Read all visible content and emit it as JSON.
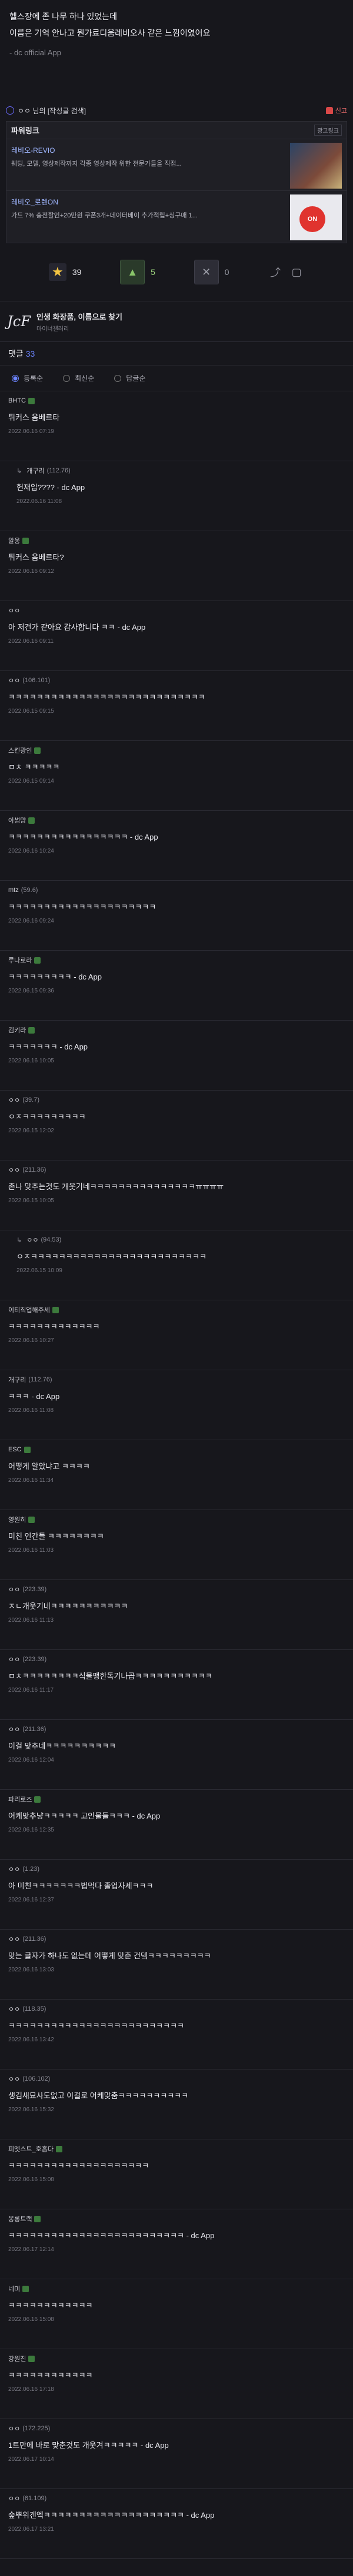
{
  "post": {
    "lines": [
      "헬스장에 존 나무 하나 있었는데",
      "이름은 기억 안나고 뭔가료디움레비오사 같은 느낌이였어요"
    ],
    "signature": "- dc official App"
  },
  "user_bar": {
    "user": "ㅇㅇ 님의 [작성글 검색]",
    "report": "신고"
  },
  "ad": {
    "header": "파워링크",
    "ad_label": "광고링크",
    "items": [
      {
        "title": "레비오-REVIO",
        "desc": "웨딩, 모델, 영상제작까지 각종 영상제작 위한 전문가들을 직접..."
      },
      {
        "title": "레비오_로렌ON",
        "desc": "가드 7% 충전할인+20만원 쿠폰3개+데이터베이 추가적립+싱구매 1..."
      }
    ]
  },
  "actions": {
    "star_count": "39",
    "up_count": "5",
    "down_count": "0"
  },
  "gallery": {
    "name": "인생 화장품, 이름으로 찾기",
    "sub": "마이너갤러리"
  },
  "comments_header": {
    "label": "댓글",
    "count": "33"
  },
  "sort": [
    "등록순",
    "최신순",
    "답글순"
  ],
  "comments": [
    {
      "reply": false,
      "nick": "BHTC",
      "ip": "",
      "gall": true,
      "body": "튀커스 옴베르타",
      "date": "2022.06.16 07:19"
    },
    {
      "reply": true,
      "nick": "개구리",
      "ip": "(112.76)",
      "gall": false,
      "body": "헌재입???? - dc App",
      "date": "2022.06.16 11:08"
    },
    {
      "reply": false,
      "nick": "알옹",
      "ip": "",
      "gall": true,
      "body": "튀커스 옴베르타?",
      "date": "2022.06.16 09:12"
    },
    {
      "reply": false,
      "nick": "ㅇㅇ",
      "ip": "",
      "gall": false,
      "body": "아 저건가 같아요 감사합니다 ㅋㅋ - dc App",
      "date": "2022.06.16 09:11"
    },
    {
      "reply": false,
      "nick": "ㅇㅇ",
      "ip": "(106.101)",
      "gall": false,
      "body": "ㅋㅋㅋㅋㅋㅋㅋㅋㅋㅋㅋㅋㅋㅋㅋㅋㅋㅋㅋㅋㅋㅋㅋㅋㅋㅋㅋㅋ",
      "date": "2022.06.15 09:15"
    },
    {
      "reply": false,
      "nick": "스킨광인",
      "ip": "",
      "gall": true,
      "body": "ㅁㅊ ㅋㅋㅋㅋㅋ",
      "date": "2022.06.15 09:14"
    },
    {
      "reply": false,
      "nick": "아썸맘",
      "ip": "",
      "gall": true,
      "body": "ㅋㅋㅋㅋㅋㅋㅋㅋㅋㅋㅋㅋㅋㅋㅋㅋㅋ - dc App",
      "date": "2022.06.16 10:24"
    },
    {
      "reply": false,
      "nick": "mtz",
      "ip": "(59.6)",
      "gall": false,
      "body": "ㅋㅋㅋㅋㅋㅋㅋㅋㅋㅋㅋㅋㅋㅋㅋㅋㅋㅋㅋㅋㅋ",
      "date": "2022.06.16 09:24"
    },
    {
      "reply": false,
      "nick": "루나로라",
      "ip": "",
      "gall": true,
      "body": "ㅋㅋㅋㅋㅋㅋㅋㅋㅋ - dc App",
      "date": "2022.06.15 09:36"
    },
    {
      "reply": false,
      "nick": "김키라",
      "ip": "",
      "gall": true,
      "body": "ㅋㅋㅋㅋㅋㅋㅋ - dc App",
      "date": "2022.06.16 10:05"
    },
    {
      "reply": false,
      "nick": "ㅇㅇ",
      "ip": "(39.7)",
      "gall": false,
      "body": "ㅇㅈㅋㅋㅋㅋㅋㅋㅋㅋㅋ",
      "date": "2022.06.15 12:02"
    },
    {
      "reply": false,
      "nick": "ㅇㅇ",
      "ip": "(211.36)",
      "gall": false,
      "body": "존나 맞추는것도 개웃기네ㅋㅋㅋㅋㅋㅋㅋㅋㅋㅋㅋㅋㅋㅋㅋㅠㅠㅠㅠ",
      "date": "2022.06.15 10:05"
    },
    {
      "reply": true,
      "nick": "ㅇㅇ",
      "ip": "(94.53)",
      "gall": false,
      "body": "ㅇㅈㅋㅋㅋㅋㅋㅋㅋㅋㅋㅋㅋㅋㅋㅋㅋㅋㅋㅋㅋㅋㅋㅋㅋㅋㅋ",
      "date": "2022.06.15 10:09"
    },
    {
      "reply": false,
      "nick": "이티직업해주세",
      "ip": "",
      "gall": true,
      "body": "ㅋㅋㅋㅋㅋㅋㅋㅋㅋㅋㅋㅋㅋ",
      "date": "2022.06.16 10:27"
    },
    {
      "reply": false,
      "nick": "개구리",
      "ip": "(112.76)",
      "gall": false,
      "body": "ㅋㅋㅋ - dc App",
      "date": "2022.06.16 11:08"
    },
    {
      "reply": false,
      "nick": "ESC",
      "ip": "",
      "gall": true,
      "body": "어떻게 알았냐고 ㅋㅋㅋㅋ",
      "date": "2022.06.16 11:34"
    },
    {
      "reply": false,
      "nick": "영원히",
      "ip": "",
      "gall": true,
      "body": "미친 인간들 ㅋㅋㅋㅋㅋㅋㅋㅋ",
      "date": "2022.06.16 11:03"
    },
    {
      "reply": false,
      "nick": "ㅇㅇ",
      "ip": "(223.39)",
      "gall": false,
      "body": "ㅈㄴ개웃기네ㅋㅋㅋㅋㅋㅋㅋㅋㅋㅋㅋ",
      "date": "2022.06.16 11:13"
    },
    {
      "reply": false,
      "nick": "ㅇㅇ",
      "ip": "(223.39)",
      "gall": false,
      "body": "ㅁㅊㅋㅋㅋㅋㅋㅋㅋㅋ식물맹한독기나곱ㅋㅋㅋㅋㅋㅋㅋㅋㅋㅋㅋ",
      "date": "2022.06.16 11:17"
    },
    {
      "reply": false,
      "nick": "ㅇㅇ",
      "ip": "(211.36)",
      "gall": false,
      "body": "이걸 맞추네ㅋㅋㅋㅋㅋㅋㅋㅋㅋㅋ",
      "date": "2022.06.16 12:04"
    },
    {
      "reply": false,
      "nick": "파리로즈",
      "ip": "",
      "gall": true,
      "body": "어케맞추냥ㅋㅋㅋㅋㅋ 고인물들ㅋㅋㅋ - dc App",
      "date": "2022.06.16 12:35"
    },
    {
      "reply": false,
      "nick": "ㅇㅇ",
      "ip": "(1.23)",
      "gall": false,
      "body": "아 미친ㅋㅋㅋㅋㅋㅋㅋ법먹다 졸업자세ㅋㅋㅋ",
      "date": "2022.06.16 12:37"
    },
    {
      "reply": false,
      "nick": "ㅇㅇ",
      "ip": "(211.36)",
      "gall": false,
      "body": "맞는 글자가 하나도 없는데 어떻게 맞춘 건뎈ㅋㅋㅋㅋㅋㅋㅋㅋㅋ",
      "date": "2022.06.16 13:03"
    },
    {
      "reply": false,
      "nick": "ㅇㅇ",
      "ip": "(118.35)",
      "gall": false,
      "body": "ㅋㅋㅋㅋㅋㅋㅋㅋㅋㅋㅋㅋㅋㅋㅋㅋㅋㅋㅋㅋㅋㅋㅋㅋㅋ",
      "date": "2022.06.16 13:42"
    },
    {
      "reply": false,
      "nick": "ㅇㅇ",
      "ip": "(106.102)",
      "gall": false,
      "body": "생김새묘사도없고 이걸로 어케맞춤ㅋㅋㅋㅋㅋㅋㅋㅋㅋㅋ",
      "date": "2022.06.16 15:32"
    },
    {
      "reply": false,
      "nick": "피엣스트_호흡다",
      "ip": "",
      "gall": true,
      "body": "ㅋㅋㅋㅋㅋㅋㅋㅋㅋㅋㅋㅋㅋㅋㅋㅋㅋㅋㅋㅋ",
      "date": "2022.06.16 15:08"
    },
    {
      "reply": false,
      "nick": "몽롱트랙",
      "ip": "",
      "gall": true,
      "body": "ㅋㅋㅋㅋㅋㅋㅋㅋㅋㅋㅋㅋㅋㅋㅋㅋㅋㅋㅋㅋㅋㅋㅋㅋㅋ - dc App",
      "date": "2022.06.17 12:14"
    },
    {
      "reply": false,
      "nick": "네미",
      "ip": "",
      "gall": true,
      "body": "ㅋㅋㅋㅋㅋㅋㅋㅋㅋㅋㅋㅋ",
      "date": "2022.06.16 15:08"
    },
    {
      "reply": false,
      "nick": "강원진",
      "ip": "",
      "gall": true,
      "body": "ㅋㅋㅋㅋㅋㅋㅋㅋㅋㅋㅋㅋ",
      "date": "2022.06.16 17:18"
    },
    {
      "reply": false,
      "nick": "ㅇㅇ",
      "ip": "(172.225)",
      "gall": false,
      "body": "1트만에 바로 맞춘것도 개웃겨ㅋㅋㅋㅋㅋ - dc App",
      "date": "2022.06.17 10:14"
    },
    {
      "reply": false,
      "nick": "ㅇㅇ",
      "ip": "(61.109)",
      "gall": false,
      "body": "숲뿌위겐엑ㅋㅋㅋㅋㅋㅋㅋㅋㅋㅋㅋㅋㅋㅋㅋㅋㅋㅋㅋㅋ - dc App",
      "date": "2022.06.17 13:21"
    }
  ]
}
